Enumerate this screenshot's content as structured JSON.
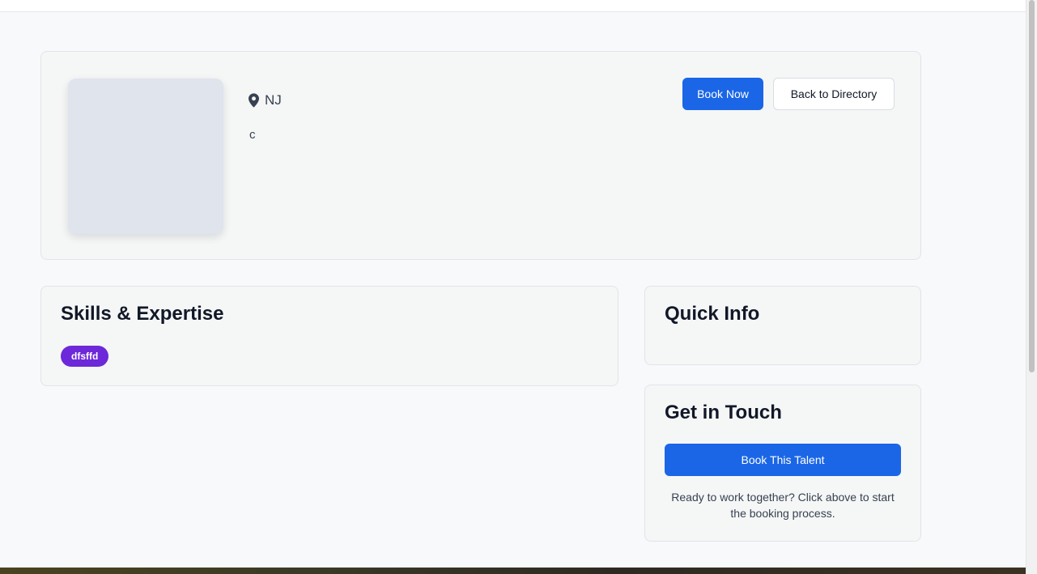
{
  "profile": {
    "location": "NJ",
    "bio": "c",
    "actions": {
      "book_now_label": "Book Now",
      "back_label": "Back to Directory"
    }
  },
  "skills": {
    "title": "Skills & Expertise",
    "tags": [
      "dfsffd"
    ]
  },
  "quick_info": {
    "title": "Quick Info"
  },
  "get_in_touch": {
    "title": "Get in Touch",
    "button_label": "Book This Talent",
    "note": "Ready to work together? Click above to start the booking process."
  },
  "colors": {
    "primary": "#1a66e6",
    "tag": "#6d28d9",
    "photo_placeholder": "#dfe4ed"
  },
  "icons": {
    "location": "map-pin-icon"
  }
}
